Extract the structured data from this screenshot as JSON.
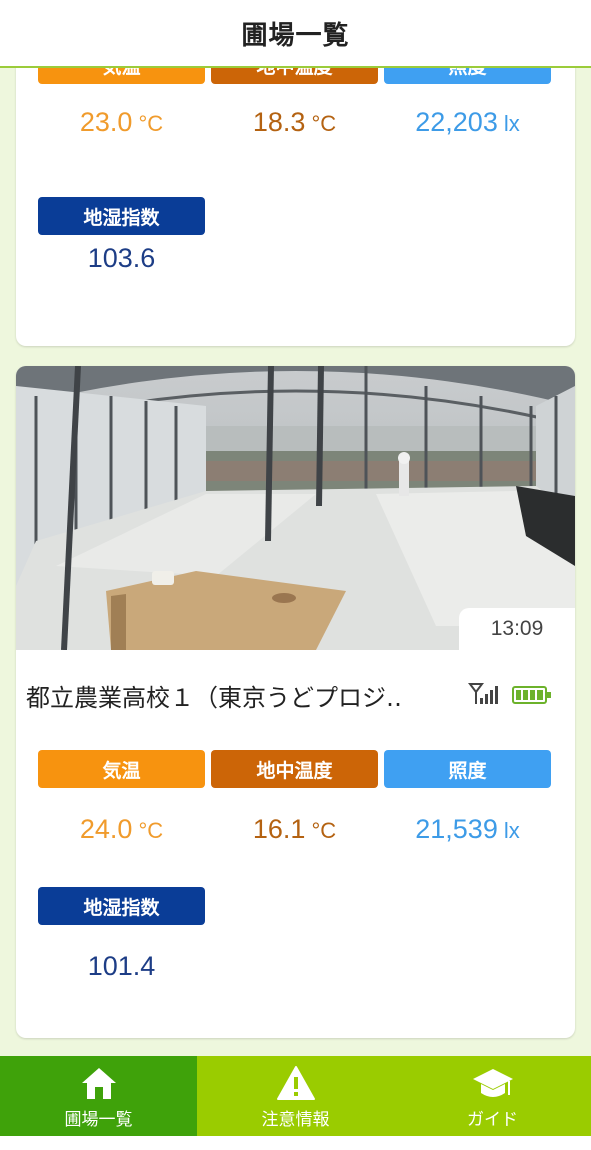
{
  "header": {
    "title": "圃場一覧"
  },
  "cards": [
    {
      "sensors": {
        "air_temp": {
          "label": "気温",
          "value": "23.0",
          "unit": "°C"
        },
        "soil_temp": {
          "label": "地中温度",
          "value": "18.3",
          "unit": "°C"
        },
        "illuminance": {
          "label": "照度",
          "value": "22,203",
          "unit": "lx"
        },
        "soil_moisture": {
          "label": "地湿指数",
          "value": "103.6"
        }
      }
    },
    {
      "time": "13:09",
      "title": "都立農業高校１（東京うどプロジ‥",
      "sensors": {
        "air_temp": {
          "label": "気温",
          "value": "24.0",
          "unit": "°C"
        },
        "soil_temp": {
          "label": "地中温度",
          "value": "16.1",
          "unit": "°C"
        },
        "illuminance": {
          "label": "照度",
          "value": "21,539",
          "unit": "lx"
        },
        "soil_moisture": {
          "label": "地湿指数",
          "value": "101.4"
        }
      }
    }
  ],
  "nav": {
    "items": [
      {
        "label": "圃場一覧",
        "icon": "home-icon"
      },
      {
        "label": "注意情報",
        "icon": "warning-icon"
      },
      {
        "label": "ガイド",
        "icon": "graduation-cap-icon"
      }
    ]
  },
  "colors": {
    "brand_green": "#3fa20a",
    "nav_lime": "#9acc00",
    "air_temp": "#f7930f",
    "soil_temp": "#cc6507",
    "illuminance": "#3fa0f2",
    "soil_moisture": "#0a3d97"
  }
}
